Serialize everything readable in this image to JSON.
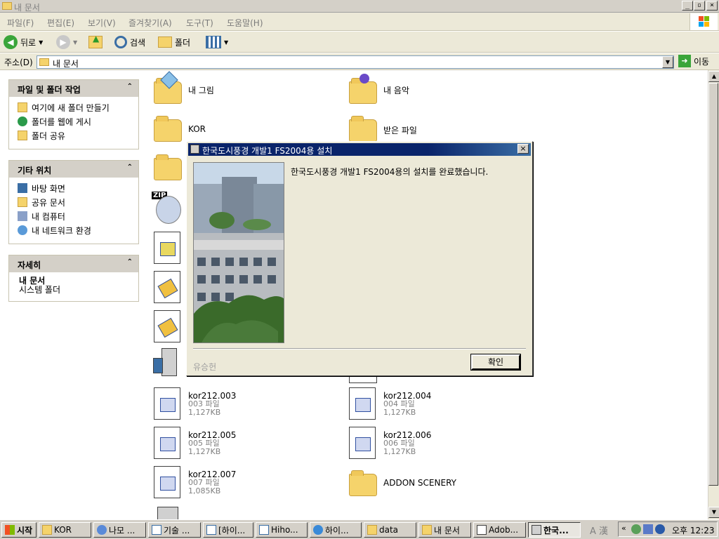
{
  "window": {
    "title": "내 문서"
  },
  "menu": [
    "파일(F)",
    "편집(E)",
    "보기(V)",
    "즐겨찾기(A)",
    "도구(T)",
    "도움말(H)"
  ],
  "toolbar": {
    "back_label": "뒤로",
    "search_label": "검색",
    "folders_label": "폴더"
  },
  "address": {
    "label": "주소(D)",
    "value": "내 문서",
    "go_label": "이동"
  },
  "left_panel": {
    "tasks": {
      "title": "파일 및 폴더 작업",
      "items": [
        "여기에 새 폴더 만들기",
        "폴더를 웹에 게시",
        "폴더 공유"
      ]
    },
    "places": {
      "title": "기타 위치",
      "items": [
        "바탕 화면",
        "공유 문서",
        "내 컴퓨터",
        "내 네트워크 환경"
      ]
    },
    "details": {
      "title": "자세히",
      "name": "내 문서",
      "type": "시스템 폴더"
    }
  },
  "files": {
    "f1": "내 그림",
    "f2": "내 음악",
    "f3": "KOR",
    "f4": "받은 파일",
    "k3": {
      "name": "kor212.003",
      "type": "003 파일",
      "size": "1,127KB"
    },
    "k4": {
      "name": "kor212.004",
      "type": "004 파일",
      "size": "1,127KB"
    },
    "k5": {
      "name": "kor212.005",
      "type": "005 파일",
      "size": "1,127KB"
    },
    "k6": {
      "name": "kor212.006",
      "type": "006 파일",
      "size": "1,127KB"
    },
    "k7": {
      "name": "kor212.007",
      "type": "007 파일",
      "size": "1,085KB"
    },
    "addon": "ADDON SCENERY",
    "zip_badge": "ZIP"
  },
  "dialog": {
    "title": "한국도시풍경 개발1 FS2004용 설치",
    "message": "한국도시풍경 개발1 FS2004용의 설치를 완료했습니다.",
    "author": "유승헌",
    "ok_label": "확인",
    "close_label": "×"
  },
  "taskbar": {
    "start_label": "시작",
    "buttons": [
      "KOR",
      "나모 ...",
      "기술 ...",
      "[하이...",
      "Hiho...",
      "하이...",
      "data",
      "내 문서",
      "Adob...",
      "한국..."
    ],
    "tray_lang": "A 漢",
    "clock": "오후 12:23"
  }
}
